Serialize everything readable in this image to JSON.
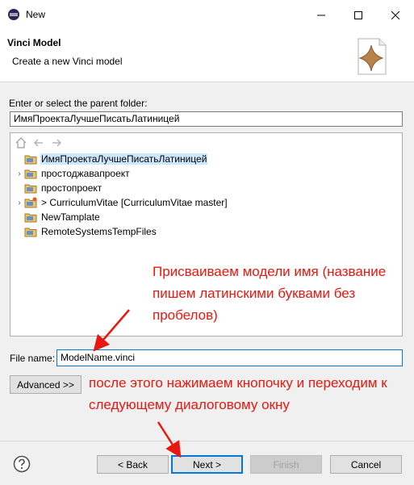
{
  "window": {
    "title": "New",
    "minimize_icon": "minimize-icon",
    "maximize_icon": "maximize-icon",
    "close_icon": "close-icon"
  },
  "banner": {
    "title": "Vinci Model",
    "description": "Create a new Vinci model",
    "image_icon": "vinci-star-icon",
    "star_color": "#b8834a"
  },
  "form": {
    "folder_label": "Enter or select the parent folder:",
    "folder_value": "ИмяПроектаЛучшеПисатьЛатиницей",
    "tree_items": [
      {
        "label": "ИмяПроектаЛучшеПисатьЛатиницей",
        "expandable": false,
        "selected": true
      },
      {
        "label": "простоджавапроект",
        "expandable": true,
        "selected": false
      },
      {
        "label": "простопроект",
        "expandable": false,
        "selected": false
      },
      {
        "label": "> CurriculumVitae [CurriculumVitae master]",
        "expandable": true,
        "selected": false
      },
      {
        "label": "NewTamplate",
        "expandable": false,
        "selected": false
      },
      {
        "label": "RemoteSystemsTempFiles",
        "expandable": false,
        "selected": false
      }
    ],
    "filename_label": "File name:",
    "filename_value": "ModelName.vinci",
    "advanced_label": "Advanced >>"
  },
  "buttons": {
    "back": "< Back",
    "next": "Next >",
    "finish": "Finish",
    "cancel": "Cancel"
  },
  "annotations": {
    "name_hint": "Присваиваем модели имя (название пишем латинскими буквами без пробелов)",
    "next_hint": "после этого нажимаем кнопочку и переходим к следующему диалоговому окну",
    "color": "#e8170f"
  }
}
